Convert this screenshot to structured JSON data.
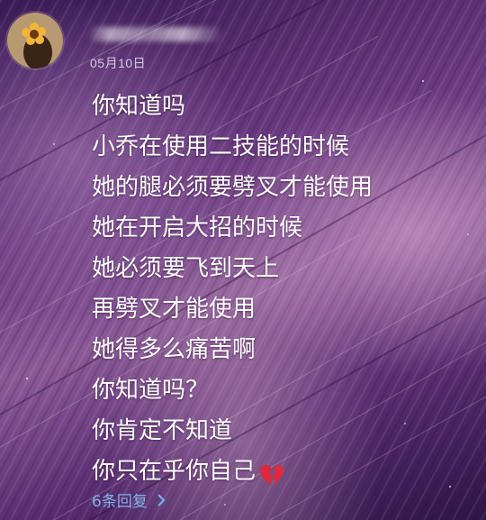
{
  "comment": {
    "username": "",
    "date": "05月10日",
    "lines": [
      "你知道吗",
      "小乔在使用二技能的时候",
      "她的腿必须要劈叉才能使用",
      "她在开启大招的时候",
      "她必须要飞到天上",
      "再劈叉才能使用",
      "她得多么痛苦啊",
      "你知道吗？",
      "你肯定不知道",
      "你只在乎你自己"
    ],
    "emoji": "broken-heart-icon",
    "replies_label": "6条回复"
  },
  "colors": {
    "text": "#ffffff",
    "date": "#d9c7e6",
    "reply_link": "#7fb2e8",
    "heart": "#e0283c"
  }
}
